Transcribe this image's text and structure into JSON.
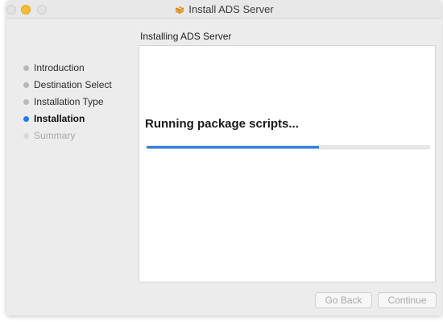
{
  "window": {
    "title": "Install ADS Server",
    "title_icon": "package-icon"
  },
  "heading": "Installing ADS Server",
  "sidebar": {
    "items": [
      {
        "label": "Introduction",
        "state": "done"
      },
      {
        "label": "Destination Select",
        "state": "done"
      },
      {
        "label": "Installation Type",
        "state": "done"
      },
      {
        "label": "Installation",
        "state": "current"
      },
      {
        "label": "Summary",
        "state": "future"
      }
    ]
  },
  "main": {
    "status_text": "Running package scripts...",
    "progress": 0.61
  },
  "buttons": {
    "back_label": "Go Back",
    "continue_label": "Continue",
    "enabled": false
  },
  "colors": {
    "accent": "#2f7fe6",
    "current_step_dot": "#1a7df0",
    "minimize_button": "#f7be2f"
  }
}
